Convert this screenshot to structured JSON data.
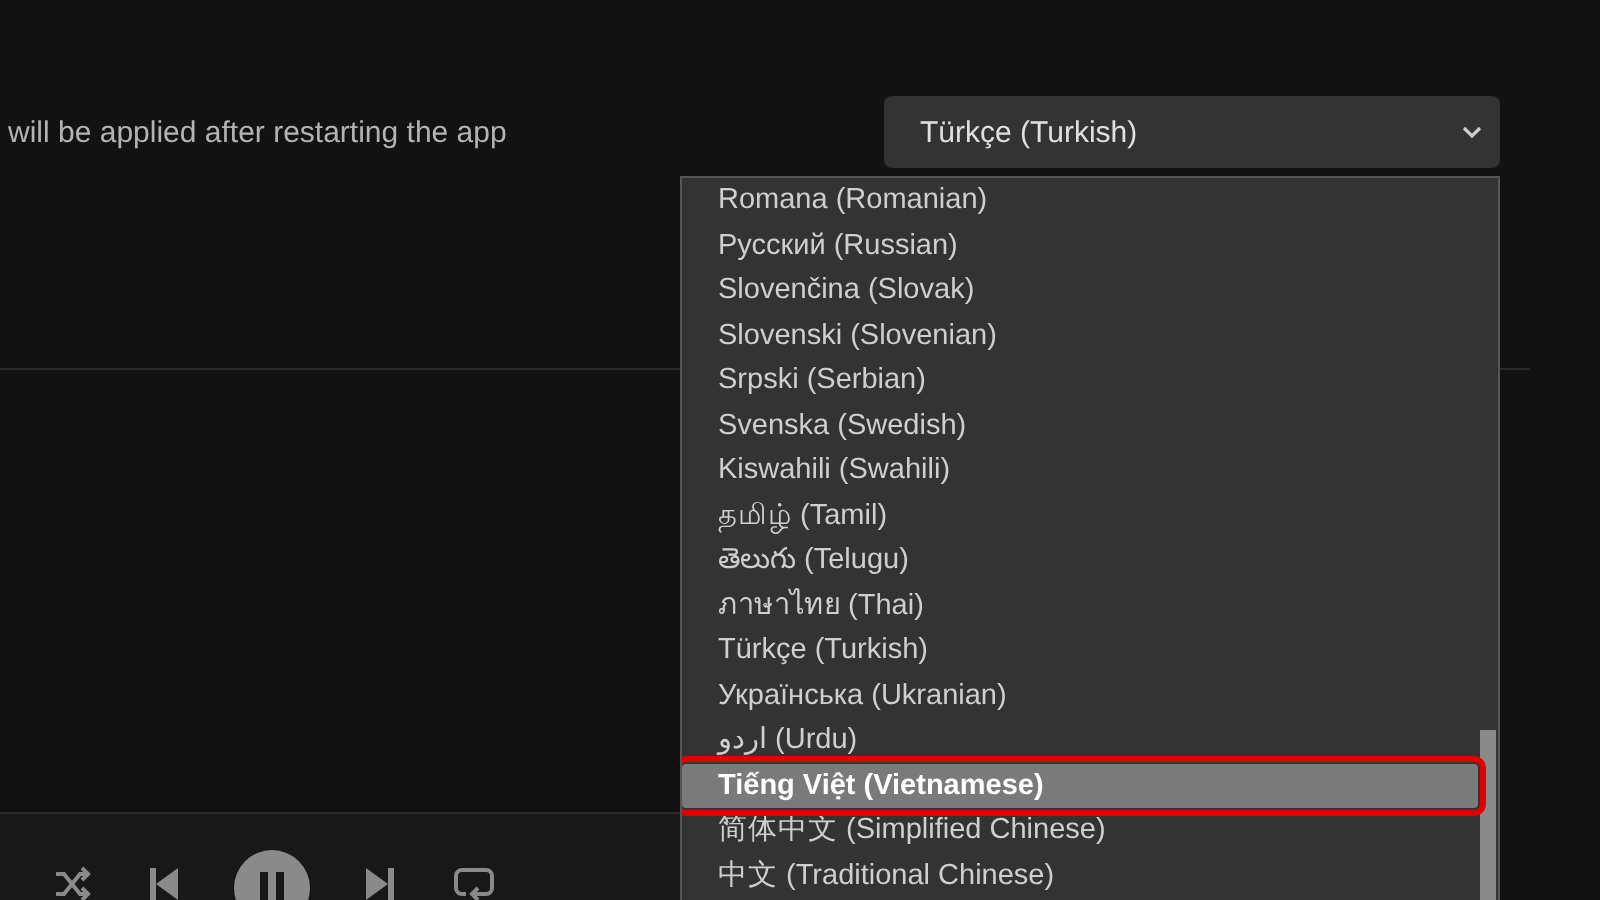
{
  "settings": {
    "note": "will be applied after restarting the app",
    "language_select": {
      "value": "Türkçe (Turkish)",
      "expanded": true
    }
  },
  "language_options": [
    {
      "label": "Romana (Romanian)",
      "selected": false,
      "highlighted": false
    },
    {
      "label": "Русский (Russian)",
      "selected": false,
      "highlighted": false
    },
    {
      "label": "Slovenčina (Slovak)",
      "selected": false,
      "highlighted": false
    },
    {
      "label": "Slovenski (Slovenian)",
      "selected": false,
      "highlighted": false
    },
    {
      "label": "Srpski (Serbian)",
      "selected": false,
      "highlighted": false
    },
    {
      "label": "Svenska (Swedish)",
      "selected": false,
      "highlighted": false
    },
    {
      "label": "Kiswahili (Swahili)",
      "selected": false,
      "highlighted": false
    },
    {
      "label": "தமிழ் (Tamil)",
      "selected": false,
      "highlighted": false
    },
    {
      "label": "తెలుగు (Telugu)",
      "selected": false,
      "highlighted": false
    },
    {
      "label": "ภาษาไทย (Thai)",
      "selected": false,
      "highlighted": false
    },
    {
      "label": "Türkçe (Turkish)",
      "selected": false,
      "highlighted": false
    },
    {
      "label": "Українська (Ukranian)",
      "selected": false,
      "highlighted": false
    },
    {
      "label": "اردو (Urdu)",
      "selected": false,
      "highlighted": false
    },
    {
      "label": "Tiếng Việt (Vietnamese)",
      "selected": true,
      "highlighted": true
    },
    {
      "label": "简体中文 (Simplified Chinese)",
      "selected": false,
      "highlighted": false
    },
    {
      "label": "中文 (Traditional Chinese)",
      "selected": false,
      "highlighted": false
    }
  ]
}
